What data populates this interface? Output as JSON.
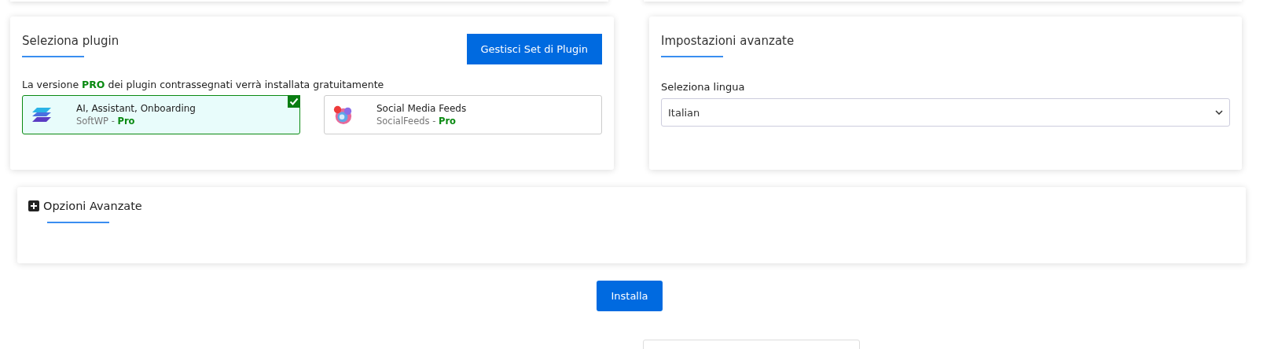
{
  "plugin_panel": {
    "title": "Seleziona plugin",
    "manage_button": "Gestisci Set di Plugin",
    "notice": "La versione **PRO** dei plugin contrassegnati verrà installata gratuitamente",
    "plugins": [
      {
        "name": "AI, Assistant, Onboarding",
        "vendor": "SoftWP",
        "separator": "-",
        "edition": "Pro",
        "kind": "layers",
        "checked": true
      },
      {
        "name": "Social Media Feeds",
        "vendor": "SocialFeeds",
        "separator": "-",
        "edition": "Pro",
        "kind": "social",
        "checked": false
      }
    ]
  },
  "advanced_settings": {
    "title": "Impostazioni avanzate",
    "language_label": "Seleziona lingua",
    "language": "Italian"
  },
  "advanced_options": {
    "title": "Opzioni Avanzate",
    "expanded": false
  },
  "install_button": "Installa"
}
